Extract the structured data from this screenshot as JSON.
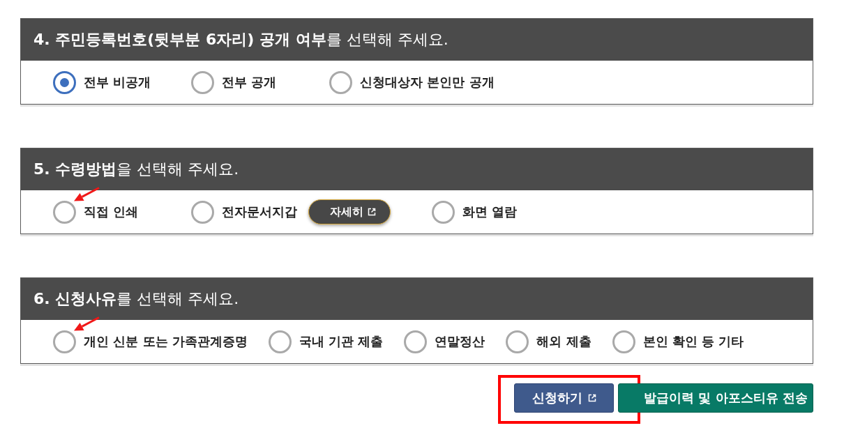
{
  "sections": [
    {
      "title": "**4. 주민등록번호(뒷부분 6자리) 공개 여부**를 선택해 주세요.",
      "options": [
        {
          "label": "전부 비공개",
          "selected": true,
          "pointed": false
        },
        {
          "label": "전부 공개",
          "selected": false,
          "pointed": false
        },
        {
          "label": "신청대상자 본인만 공개",
          "selected": false,
          "pointed": false
        }
      ]
    },
    {
      "title": "**5. 수령방법**을 선택해 주세요.",
      "options": [
        {
          "label": "직접 인쇄",
          "selected": false,
          "pointed": true
        },
        {
          "label": "전자문서지갑",
          "selected": false,
          "pointed": false,
          "detail_button": {
            "label": "자세히"
          }
        },
        {
          "label": "화면 열람",
          "selected": false,
          "pointed": false
        }
      ]
    },
    {
      "title": "**6. 신청사유**를 선택해 주세요.",
      "options": [
        {
          "label": "개인 신분 또는 가족관계증명",
          "selected": false,
          "pointed": true
        },
        {
          "label": "국내 기관 제출",
          "selected": false,
          "pointed": false
        },
        {
          "label": "연말정산",
          "selected": false,
          "pointed": false
        },
        {
          "label": "해외 제출",
          "selected": false,
          "pointed": false
        },
        {
          "label": "본인 확인 등 기타",
          "selected": false,
          "pointed": false
        }
      ]
    }
  ],
  "buttons": [
    {
      "label": "신청하기",
      "kind": "primary",
      "external": true,
      "highlighted": true
    },
    {
      "label": "발급이력 및 아포스티유 전송",
      "kind": "secondary",
      "external": false,
      "highlighted": false
    }
  ]
}
